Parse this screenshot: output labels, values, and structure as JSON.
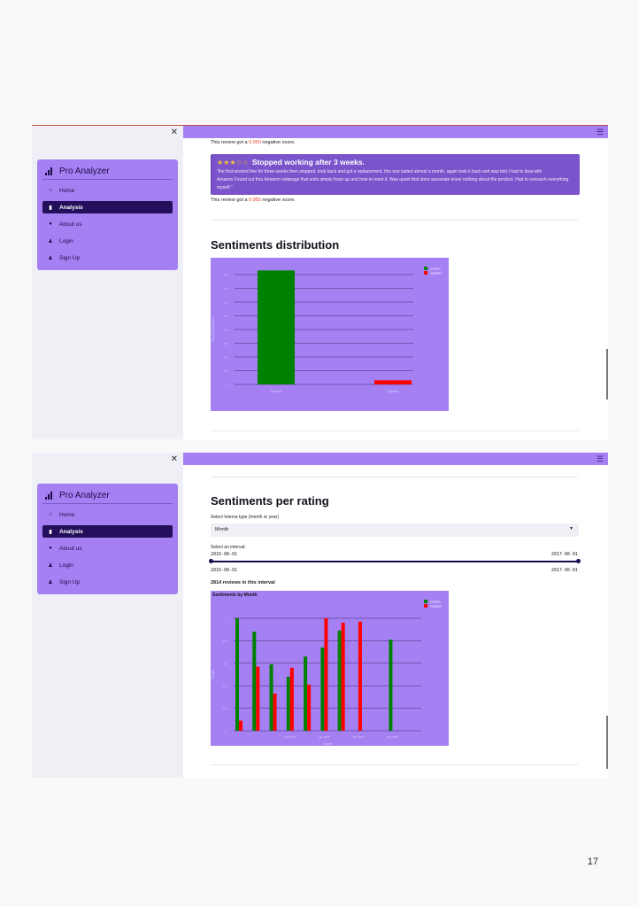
{
  "sidebar": {
    "close_icon": "close-icon",
    "brand": "Pro Analyzer",
    "items": [
      {
        "label": "Home",
        "icon": "home-icon"
      },
      {
        "label": "Analysis",
        "icon": "bar-chart-icon",
        "active": true
      },
      {
        "label": "About us",
        "icon": "info-icon"
      },
      {
        "label": "Login",
        "icon": "user-icon"
      },
      {
        "label": "Sign Up",
        "icon": "user-plus-icon"
      }
    ]
  },
  "colors": {
    "accent": "#a580f2",
    "active": "#240f5c",
    "positive": "#008000",
    "negative": "#ff0000",
    "sidebar_bg": "#eff0f6"
  },
  "screen1": {
    "prev_score_prefix": "This review got a ",
    "prev_score_value": "0.050",
    "prev_score_suffix": " negative score.",
    "review": {
      "stars": "★★★☆☆",
      "title": "Stopped working after 3 weeks.",
      "text": "\"the first worked fine for three weeks then stopped. took back and got a replacement. this one lasted almost a month. again took it back and was told I had to deal with Amazon.Found out thru Amazon webpage that units simply froze up and how to reset it. Was upset that store associate knew nothing about the product. Had to research everything myself.\"",
      "score_prefix": "This review got a ",
      "score_value": "0.955",
      "score_suffix": " negative score."
    },
    "section_title": "Sentiments distribution"
  },
  "chart_data": [
    {
      "type": "bar",
      "title": "",
      "categories": [
        "positive",
        "negative"
      ],
      "series": [
        {
          "name": "positive",
          "values": [
            0.83,
            null
          ],
          "color": "#008000"
        },
        {
          "name": "negative",
          "values": [
            null,
            0.03
          ],
          "color": "#ff0000"
        }
      ],
      "xlabel": "",
      "ylabel": "Normal frequency",
      "ylim": [
        0,
        0.8
      ],
      "yticks": [
        "0",
        "0.1",
        "0.2",
        "0.3",
        "0.4",
        "0.5",
        "0.6",
        "0.7",
        "0.8"
      ],
      "legend": "top-right",
      "grid": true
    },
    {
      "type": "bar",
      "title": "Sentiments by Month",
      "categories": [
        "2016-08",
        "2016-09",
        "2016-10",
        "2016-11",
        "2016-12",
        "2017-01",
        "2017-02",
        "2017-03",
        "2017-04",
        "2017-05",
        "2017-06"
      ],
      "series": [
        {
          "name": "positive",
          "values": [
            1.0,
            0.88,
            0.59,
            0.48,
            0.66,
            0.74,
            0.89,
            0,
            0,
            0.81,
            0
          ],
          "color": "#008000"
        },
        {
          "name": "negative",
          "values": [
            0.09,
            0.57,
            0.33,
            0.56,
            0.41,
            1.0,
            0.96,
            0.97,
            0,
            0,
            0
          ],
          "color": "#ff0000"
        }
      ],
      "xticks": [
        "Nov 2016",
        "Jan 2017",
        "Mar 2017",
        "May 2017"
      ],
      "xlabel": "Month",
      "ylabel": "Trends",
      "ylim": [
        0,
        1
      ],
      "yticks": [
        "0",
        "0.2",
        "0.4",
        "0.6",
        "0.8",
        "1"
      ],
      "legend": "top-right",
      "grid": true
    }
  ],
  "screen2": {
    "section_title": "Sentiments per rating",
    "interval_type_label": "Select Interva type (month or year)",
    "interval_type_value": "Month",
    "interval_label": "Select an interval:",
    "slider_start": "2016-08-01",
    "slider_end": "2017-06-01",
    "range_start": "2016-08-01",
    "range_end": "2017-06-01",
    "reviews_count": "2814 reviews in this interval"
  },
  "page_number": "17"
}
